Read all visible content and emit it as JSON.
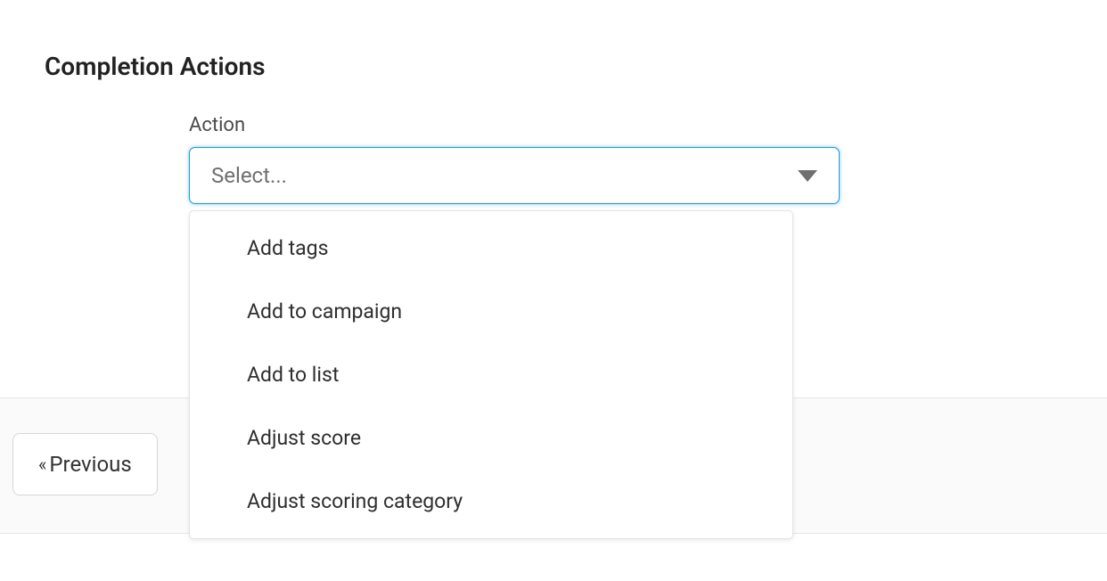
{
  "page": {
    "title": "Completion Actions"
  },
  "field": {
    "label": "Action",
    "placeholder": "Select..."
  },
  "dropdown": {
    "options": [
      "Add tags",
      "Add to campaign",
      "Add to list",
      "Adjust score",
      "Adjust scoring category"
    ]
  },
  "footer": {
    "previous_label": "Previous"
  }
}
